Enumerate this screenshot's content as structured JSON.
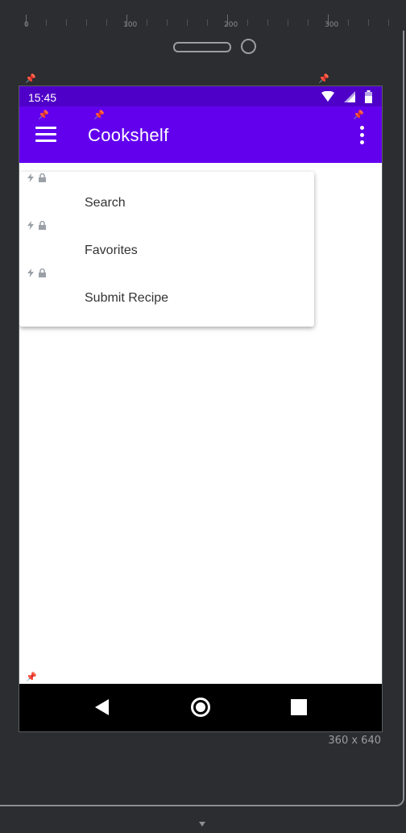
{
  "editor": {
    "ruler_labels": [
      "0",
      "100",
      "200",
      "300"
    ],
    "device_size_label": "360 x 640"
  },
  "status_bar": {
    "time": "15:45",
    "background_color": "#4f00c8",
    "icons": [
      "wifi-icon",
      "signal-icon",
      "battery-icon"
    ]
  },
  "app_bar": {
    "title": "Cookshelf",
    "background_color": "#6200ee",
    "nav_icon": "hamburger-menu-icon",
    "action_icon": "more-vert-icon"
  },
  "menu": {
    "items": [
      {
        "label": "Search"
      },
      {
        "label": "Favorites"
      },
      {
        "label": "Submit Recipe"
      }
    ]
  },
  "nav_bar": {
    "buttons": [
      "back-icon",
      "home-icon",
      "recents-icon"
    ]
  }
}
